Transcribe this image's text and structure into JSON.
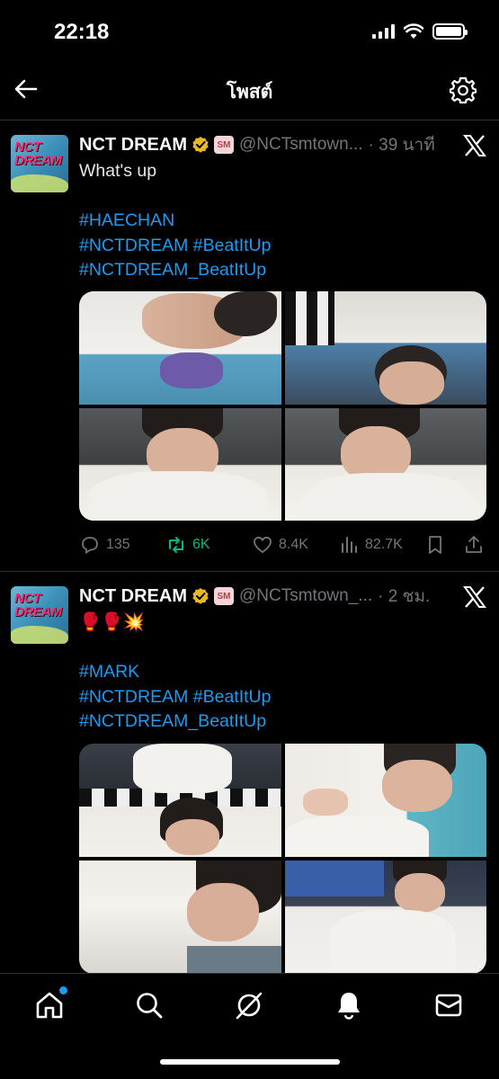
{
  "status_bar": {
    "time": "22:18"
  },
  "header": {
    "title": "โพสต์",
    "back_icon": "arrow-left-icon",
    "settings_icon": "gear-icon"
  },
  "posts": [
    {
      "author": "NCT DREAM",
      "avatar_text": "NCT DREAM",
      "affiliate_badge": "SM",
      "handle": "@NCTsmtown...",
      "time": "· 39 นาที",
      "lines": [
        "What's up",
        "",
        "#HAECHAN",
        "#NCTDREAM #BeatItUp",
        "#NCTDREAM_BeatItUp"
      ],
      "stats": {
        "replies": "135",
        "reposts": "6K",
        "likes": "8.4K",
        "views": "82.7K"
      }
    },
    {
      "author": "NCT DREAM",
      "avatar_text": "NCT DREAM",
      "affiliate_badge": "SM",
      "handle": "@NCTsmtown_...",
      "time": "· 2 ชม.",
      "lines": [
        "🥊🥊💥",
        "",
        "#MARK",
        "#NCTDREAM #BeatItUp",
        "#NCTDREAM_BeatItUp"
      ]
    }
  ],
  "tab_bar": {
    "items": [
      "home-icon",
      "search-icon",
      "grok-icon",
      "bell-icon",
      "mail-icon"
    ]
  },
  "colors": {
    "accent": "#1d9bf0",
    "repost_green": "#00ba7c",
    "secondary_text": "#71767b"
  }
}
